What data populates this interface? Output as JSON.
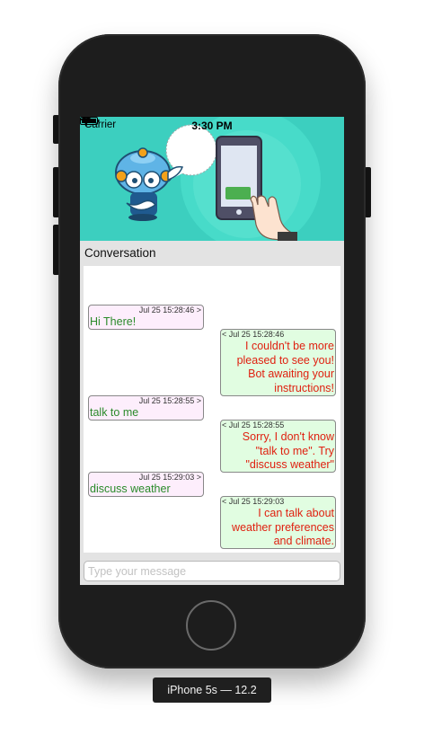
{
  "status_bar": {
    "carrier": "Carrier",
    "time": "3:30 PM"
  },
  "conversation": {
    "title": "Conversation",
    "messages": [
      {
        "sender": "user",
        "timestamp": "Jul 25 15:28:46 >",
        "text": "Hi There!"
      },
      {
        "sender": "bot",
        "timestamp": "< Jul 25 15:28:46",
        "text": "I couldn't be more pleased to see you! Bot awaiting your instructions!"
      },
      {
        "sender": "user",
        "timestamp": "Jul 25 15:28:55 >",
        "text": "talk to me"
      },
      {
        "sender": "bot",
        "timestamp": "< Jul 25 15:28:55",
        "text": "Sorry, I don't know \"talk to me\". Try \"discuss weather\""
      },
      {
        "sender": "user",
        "timestamp": "Jul 25 15:29:03 >",
        "text": "discuss weather"
      },
      {
        "sender": "bot",
        "timestamp": "< Jul 25 15:29:03",
        "text": "I can talk about weather preferences and climate."
      }
    ]
  },
  "input": {
    "placeholder": "Type your message",
    "value": ""
  },
  "device_label": "iPhone 5s — 12.2",
  "colors": {
    "banner_teal": "#3ccfbf",
    "user_bubble_bg": "#fdeefc",
    "user_text": "#2a8a2a",
    "bot_bubble_bg": "#e1fde1",
    "bot_text": "#e02010"
  },
  "icons": {
    "wifi": "wifi-icon",
    "battery": "battery-icon",
    "robot": "robot-mascot-illustration",
    "phone": "smartphone-hand-illustration"
  }
}
